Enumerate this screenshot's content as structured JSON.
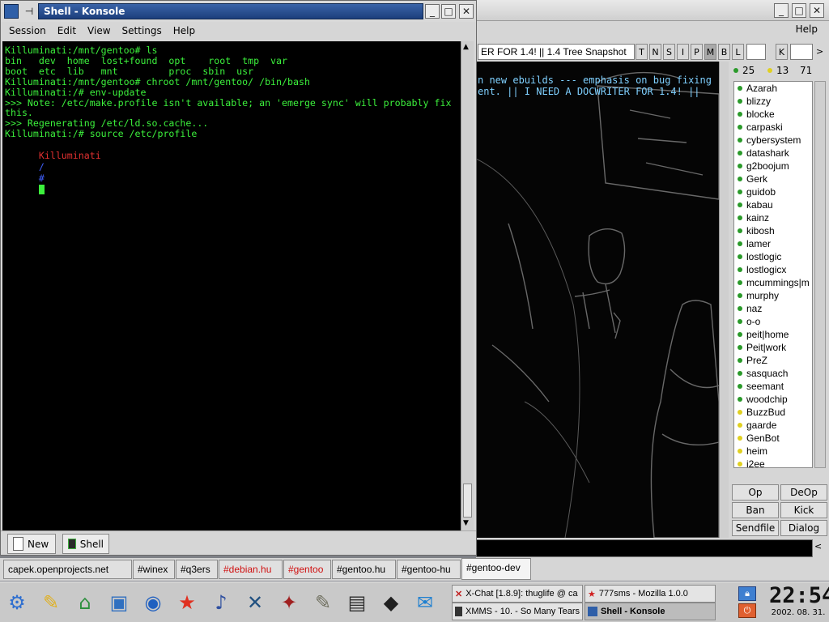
{
  "konsole": {
    "title": "Shell - Konsole",
    "menu": [
      "Session",
      "Edit",
      "View",
      "Settings",
      "Help"
    ],
    "lines": [
      {
        "text": "Killuminati:/mnt/gentoo# ls",
        "color": "#3cf03c"
      },
      {
        "text": "bin   dev  home  lost+found  opt    root  tmp  var",
        "color": "#3cf03c"
      },
      {
        "text": "boot  etc  lib   mnt         proc  sbin  usr",
        "color": "#3cf03c"
      },
      {
        "text": "Killuminati:/mnt/gentoo# chroot /mnt/gentoo/ /bin/bash",
        "color": "#3cf03c"
      },
      {
        "text": "Killuminati:/# env-update",
        "color": "#3cf03c"
      },
      {
        "text": ">>> Note: /etc/make.profile isn't available; an 'emerge sync' will probably fix",
        "color": "#3cf03c"
      },
      {
        "text": "this.",
        "color": "#3cf03c"
      },
      {
        "text": ">>> Regenerating /etc/ld.so.cache...",
        "color": "#3cf03c"
      },
      {
        "text": "Killuminati:/# source /etc/profile",
        "color": "#3cf03c"
      }
    ],
    "prompt": {
      "host": "Killuminati",
      "path": "/",
      "symbol": "#"
    },
    "sessions": {
      "new_label": "New",
      "shell_label": "Shell"
    }
  },
  "xchat": {
    "menu_help": "Help",
    "topic": "ER FOR 1.4! || 1.4 Tree Snapshot",
    "mode_buttons": [
      "T",
      "N",
      "S",
      "I",
      "P",
      "M",
      "B",
      "L"
    ],
    "key_button": "K",
    "chat_lines": [
      "n new ebuilds --- emphasis on bug fixing",
      "ent. || I NEED A DOCWRITER FOR 1.4! ||"
    ],
    "counts": {
      "ops": "25",
      "voiced": "13",
      "total": "71"
    },
    "users": [
      {
        "name": "Azarah",
        "status": "op"
      },
      {
        "name": "blizzy",
        "status": "op"
      },
      {
        "name": "blocke",
        "status": "op"
      },
      {
        "name": "carpaski",
        "status": "op"
      },
      {
        "name": "cybersystem",
        "status": "op"
      },
      {
        "name": "datashark",
        "status": "op"
      },
      {
        "name": "g2boojum",
        "status": "op"
      },
      {
        "name": "Gerk",
        "status": "op"
      },
      {
        "name": "guidob",
        "status": "op"
      },
      {
        "name": "kabau",
        "status": "op"
      },
      {
        "name": "kainz",
        "status": "op"
      },
      {
        "name": "kibosh",
        "status": "op"
      },
      {
        "name": "lamer",
        "status": "op"
      },
      {
        "name": "lostlogic",
        "status": "op"
      },
      {
        "name": "lostlogicx",
        "status": "op"
      },
      {
        "name": "mcummings|m",
        "status": "op"
      },
      {
        "name": "murphy",
        "status": "op"
      },
      {
        "name": "naz",
        "status": "op"
      },
      {
        "name": "o-o",
        "status": "op"
      },
      {
        "name": "peit|home",
        "status": "op"
      },
      {
        "name": "Peit|work",
        "status": "op"
      },
      {
        "name": "PreZ",
        "status": "op"
      },
      {
        "name": "sasquach",
        "status": "op"
      },
      {
        "name": "seemant",
        "status": "op"
      },
      {
        "name": "woodchip",
        "status": "op"
      },
      {
        "name": "BuzzBud",
        "status": "voice"
      },
      {
        "name": "gaarde",
        "status": "voice"
      },
      {
        "name": "GenBot",
        "status": "voice"
      },
      {
        "name": "heim",
        "status": "voice"
      },
      {
        "name": "i2ee",
        "status": "voice"
      }
    ],
    "buttons": [
      "Op",
      "DeOp",
      "Ban",
      "Kick",
      "Sendfile",
      "Dialog"
    ]
  },
  "channel_tabs": [
    {
      "label": "capek.openprojects.net",
      "color": "#000000",
      "active": false
    },
    {
      "label": "#winex",
      "color": "#000000",
      "active": false
    },
    {
      "label": "#q3ers",
      "color": "#000000",
      "active": false
    },
    {
      "label": "#debian.hu",
      "color": "#d01010",
      "active": false
    },
    {
      "label": "#gentoo",
      "color": "#d01010",
      "active": false
    },
    {
      "label": "#gentoo.hu",
      "color": "#000000",
      "active": false
    },
    {
      "label": "#gentoo-hu",
      "color": "#000000",
      "active": false
    },
    {
      "label": "#gentoo-dev",
      "color": "#000000",
      "active": true
    }
  ],
  "taskbar": {
    "launchers": [
      "kde-menu-icon",
      "kate-icon",
      "home-folder-icon",
      "konsole-icon",
      "konqueror-icon",
      "mozilla-icon",
      "xmms-icon",
      "xchat-icon",
      "quake-icon",
      "gimp-icon",
      "xv-icon",
      "penguin-icon",
      "kmail-icon"
    ],
    "tasks": [
      {
        "label": "X-Chat [1.8.9]: thuglife @ ca",
        "icon": "xchat-task-icon",
        "active": false
      },
      {
        "label": "777sms - Mozilla 1.0.0",
        "icon": "mozilla-task-icon",
        "active": false
      },
      {
        "label": "XMMS - 10. - So Many Tears",
        "icon": "xmms-task-icon",
        "active": false
      },
      {
        "label": "Shell - Konsole",
        "icon": "konsole-task-icon",
        "active": true
      }
    ],
    "clock_time": "22:54",
    "clock_date": "2002. 08. 31."
  }
}
